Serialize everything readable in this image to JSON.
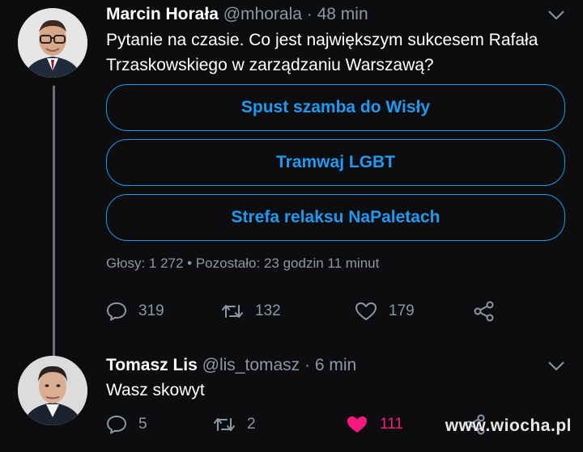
{
  "tweet1": {
    "name": "Marcin Horała",
    "handle": "@mhorala",
    "separator": "·",
    "time": "48 min",
    "text": "Pytanie na czasie. Co jest największym sukcesem Rafała Trzaskowskiego w zarządzaniu Warszawą?",
    "poll": {
      "options": [
        "Spust szamba do Wisły",
        "Tramwaj LGBT",
        "Strefa relaksu NaPaletach"
      ],
      "meta": "Głosy: 1 272 • Pozostało: 23 godzin 11 minut"
    },
    "replies": "319",
    "retweets": "132",
    "likes": "179"
  },
  "tweet2": {
    "name": "Tomasz Lis",
    "handle": "@lis_tomasz",
    "separator": "·",
    "time": "6 min",
    "text": "Wasz skowyt",
    "replies": "5",
    "retweets": "2",
    "likes": "111",
    "liked_color": "#f91880"
  },
  "watermark": "www.wiocha.pl",
  "colors": {
    "accent": "#1d9bf0",
    "muted": "#8b98a5",
    "background": "#0d0d0f"
  }
}
